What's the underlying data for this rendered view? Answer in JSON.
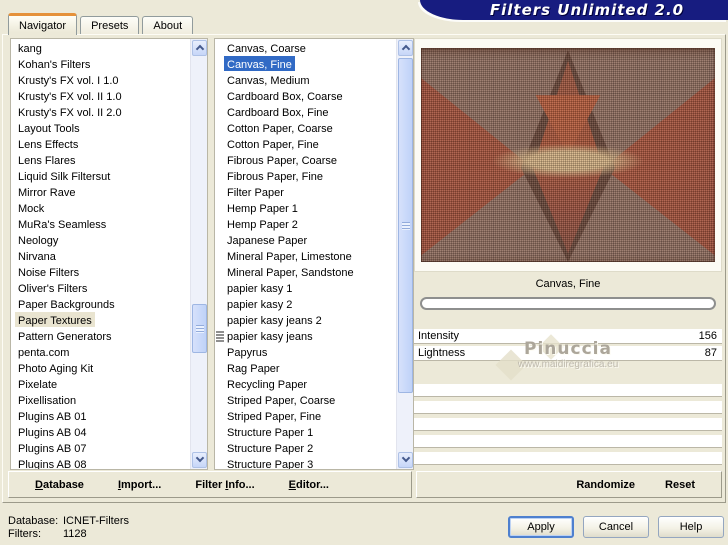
{
  "window": {
    "title": "Filters Unlimited 2.0"
  },
  "tabs": [
    {
      "label": "Navigator",
      "active": true
    },
    {
      "label": "Presets",
      "active": false
    },
    {
      "label": "About",
      "active": false
    }
  ],
  "category_list": {
    "items": [
      {
        "label": "kang"
      },
      {
        "label": "Kohan's Filters"
      },
      {
        "label": "Krusty's FX vol. I 1.0"
      },
      {
        "label": "Krusty's FX vol. II 1.0"
      },
      {
        "label": "Krusty's FX vol. II 2.0"
      },
      {
        "label": "Layout Tools"
      },
      {
        "label": "Lens Effects"
      },
      {
        "label": "Lens Flares"
      },
      {
        "label": "Liquid Silk Filtersut"
      },
      {
        "label": "Mirror Rave"
      },
      {
        "label": "Mock"
      },
      {
        "label": "MuRa's Seamless"
      },
      {
        "label": "Neology"
      },
      {
        "label": "Nirvana"
      },
      {
        "label": "Noise Filters"
      },
      {
        "label": "Oliver's Filters"
      },
      {
        "label": "Paper Backgrounds"
      },
      {
        "label": "Paper Textures",
        "selected": true
      },
      {
        "label": "Pattern Generators"
      },
      {
        "label": "penta.com"
      },
      {
        "label": "Photo Aging Kit"
      },
      {
        "label": "Pixelate"
      },
      {
        "label": "Pixellisation"
      },
      {
        "label": "Plugins AB 01"
      },
      {
        "label": "Plugins AB 04"
      },
      {
        "label": "Plugins AB 07"
      },
      {
        "label": "Plugins AB 08"
      }
    ]
  },
  "filter_list": {
    "items": [
      {
        "label": "Canvas, Coarse"
      },
      {
        "label": "Canvas, Fine",
        "selected": true
      },
      {
        "label": "Canvas, Medium"
      },
      {
        "label": "Cardboard Box, Coarse"
      },
      {
        "label": "Cardboard Box, Fine"
      },
      {
        "label": "Cotton Paper, Coarse"
      },
      {
        "label": "Cotton Paper, Fine"
      },
      {
        "label": "Fibrous Paper, Coarse"
      },
      {
        "label": "Fibrous Paper, Fine"
      },
      {
        "label": "Filter Paper"
      },
      {
        "label": "Hemp Paper 1"
      },
      {
        "label": "Hemp Paper 2"
      },
      {
        "label": "Japanese Paper"
      },
      {
        "label": "Mineral Paper, Limestone"
      },
      {
        "label": "Mineral Paper, Sandstone"
      },
      {
        "label": "papier kasy 1"
      },
      {
        "label": "papier kasy 2"
      },
      {
        "label": "papier kasy jeans 2"
      },
      {
        "label": "papier kasy jeans",
        "grip": true
      },
      {
        "label": "Papyrus"
      },
      {
        "label": "Rag Paper"
      },
      {
        "label": "Recycling Paper"
      },
      {
        "label": "Striped Paper, Coarse"
      },
      {
        "label": "Striped Paper, Fine"
      },
      {
        "label": "Structure Paper 1"
      },
      {
        "label": "Structure Paper 2"
      },
      {
        "label": "Structure Paper 3"
      }
    ]
  },
  "preview": {
    "caption": "Canvas, Fine"
  },
  "slider_rows": [
    {
      "label": "Intensity",
      "value": "156",
      "empty": false
    },
    {
      "label": "Lightness",
      "value": "87",
      "empty": false
    },
    {
      "label": "",
      "value": "",
      "empty": true
    },
    {
      "label": "",
      "value": "",
      "empty": true
    },
    {
      "label": "",
      "value": "",
      "empty": true
    },
    {
      "label": "",
      "value": "",
      "empty": true
    },
    {
      "label": "",
      "value": "",
      "empty": true
    }
  ],
  "watermark": {
    "name": "Pinuccia",
    "url": "www.maidiregrafica.eu"
  },
  "command_bar": [
    {
      "pre": "",
      "accel": "D",
      "post": "atabase"
    },
    {
      "pre": "",
      "accel": "I",
      "post": "mport..."
    },
    {
      "pre": "Filter ",
      "accel": "I",
      "post": "nfo..."
    },
    {
      "pre": "",
      "accel": "E",
      "post": "ditor..."
    }
  ],
  "action_bar": {
    "randomize": "Randomize",
    "reset": "Reset"
  },
  "status": {
    "database_label": "Database:",
    "database_value": "ICNET-Filters",
    "filters_label": "Filters:",
    "filters_value": "1128"
  },
  "dialog_buttons": {
    "apply": "Apply",
    "cancel": "Cancel",
    "help": "Help"
  },
  "colors": {
    "dialog_bg": "#ECE9D8",
    "banner_navy": "#171C80",
    "selection_blue": "#316AC5",
    "category_selection": "#E9E4D0",
    "tab_accent_orange": "#E5913A",
    "preview_red": "#B05A3E",
    "preview_mauve": "#967364",
    "preview_tan": "#D6B487"
  }
}
